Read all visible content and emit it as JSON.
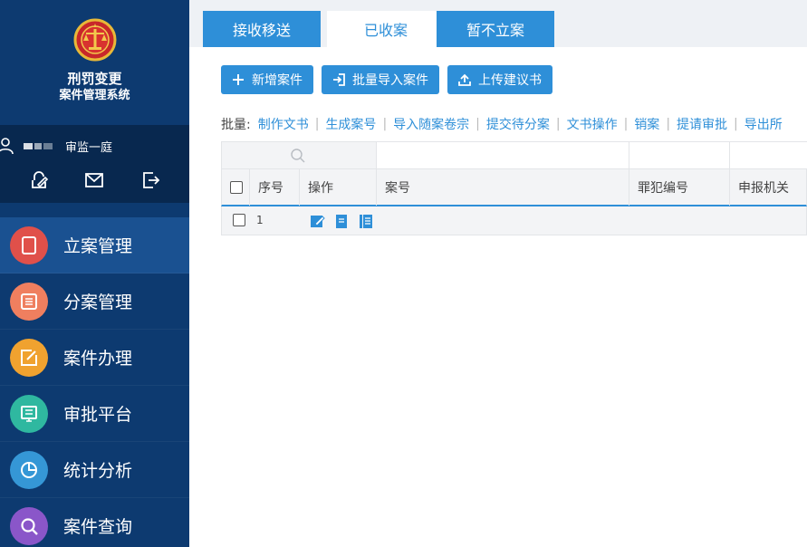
{
  "brand": {
    "title": "刑罚变更",
    "subtitle": "案件管理系统"
  },
  "user": {
    "department": "审监一庭"
  },
  "menu": [
    {
      "label": "立案管理",
      "icon": "document-icon",
      "color": "#e0504a",
      "active": true
    },
    {
      "label": "分案管理",
      "icon": "list-icon",
      "color": "#ef7f5f",
      "active": false
    },
    {
      "label": "案件办理",
      "icon": "edit-icon",
      "color": "#f0a22f",
      "active": false
    },
    {
      "label": "审批平台",
      "icon": "monitor-icon",
      "color": "#2fb8a0",
      "active": false
    },
    {
      "label": "统计分析",
      "icon": "pie-chart-icon",
      "color": "#3597d6",
      "active": false
    },
    {
      "label": "案件查询",
      "icon": "search-icon",
      "color": "#8a56c9",
      "active": false
    }
  ],
  "tabs": [
    {
      "label": "接收移送",
      "active": false
    },
    {
      "label": "已收案",
      "active": true
    },
    {
      "label": "暂不立案",
      "active": false
    }
  ],
  "toolbar": {
    "add": "新增案件",
    "import": "批量导入案件",
    "upload": "上传建议书"
  },
  "batch": {
    "label": "批量:",
    "links": [
      "制作文书",
      "生成案号",
      "导入随案卷宗",
      "提交待分案",
      "文书操作",
      "销案",
      "提请审批",
      "导出所"
    ]
  },
  "table": {
    "columns": [
      "序号",
      "操作",
      "案号",
      "罪犯编号",
      "申报机关"
    ],
    "rows": [
      {
        "index": "1"
      }
    ]
  },
  "colors": {
    "sidebar": "#0d3a70",
    "accent": "#2e8fd8",
    "active_menu": "#1a5191"
  }
}
